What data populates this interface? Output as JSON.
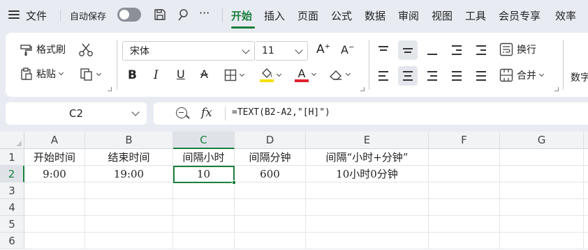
{
  "menu": {
    "file": "文件",
    "autosave": "自动保存",
    "more": "···",
    "tabs": [
      "开始",
      "插入",
      "页面",
      "公式",
      "数据",
      "审阅",
      "视图",
      "工具",
      "会员专享",
      "效率"
    ],
    "active_tab": "开始"
  },
  "ribbon": {
    "format_painter": "格式刷",
    "paste": "粘贴",
    "font_name": "宋体",
    "font_size": "11",
    "wrap_text": "换行",
    "merge": "合并",
    "number": "数字"
  },
  "formula_bar": {
    "cell_ref": "C2",
    "fx": "fx",
    "formula": "=TEXT(B2-A2,\"[H]\")"
  },
  "sheet": {
    "columns": [
      "A",
      "B",
      "C",
      "D",
      "E",
      "F",
      "G"
    ],
    "rows": [
      "1",
      "2",
      "3",
      "4",
      "5",
      "6"
    ],
    "selected_cell": "C2",
    "cells": {
      "A1": "开始时间",
      "B1": "结束时间",
      "C1": "间隔小时",
      "D1": "间隔分钟",
      "E1": "间隔“小时+分钟”",
      "A2": "9:00",
      "B2": "19:00",
      "C2": "10",
      "D2": "600",
      "E2": "10小时0分钟"
    }
  },
  "colors": {
    "accent": "#1a7f3c",
    "font_color_bar": "#e0202e",
    "fill_color_bar": "#f5e100"
  }
}
